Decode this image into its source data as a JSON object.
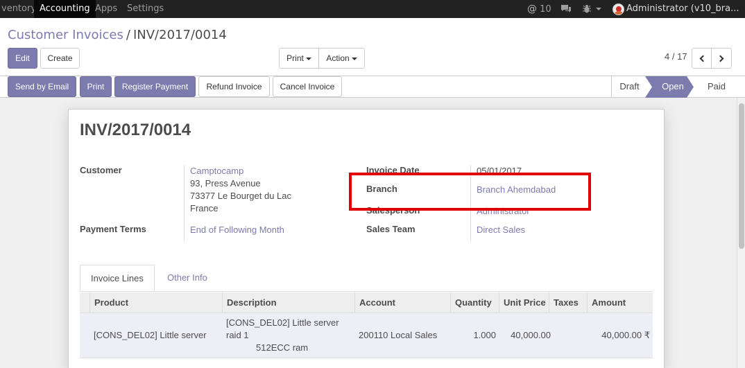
{
  "topbar": {
    "menus": [
      "ventory",
      "Accounting",
      "Apps",
      "Settings"
    ],
    "mentions": "10",
    "user": "Administrator (v10_bra..."
  },
  "breadcrumb": {
    "parent": "Customer Invoices",
    "separator": "/",
    "current": "INV/2017/0014"
  },
  "toolbar": {
    "edit": "Edit",
    "create": "Create",
    "print": "Print",
    "action": "Action",
    "pager": "4 / 17"
  },
  "actions": {
    "send_email": "Send by Email",
    "print": "Print",
    "register_payment": "Register Payment",
    "refund": "Refund Invoice",
    "cancel": "Cancel Invoice"
  },
  "stages": [
    "Draft",
    "Open",
    "Paid"
  ],
  "invoice": {
    "number": "INV/2017/0014",
    "customer_label": "Customer",
    "customer_name": "Camptocamp",
    "address_line1": "93, Press Avenue",
    "address_line2": "73377 Le Bourget du Lac",
    "address_line3": "France",
    "payment_terms_label": "Payment Terms",
    "payment_terms": "End of Following Month",
    "invoice_date_label": "Invoice Date",
    "invoice_date": "05/01/2017",
    "branch_label": "Branch",
    "branch": "Branch Ahemdabad",
    "salesperson_label": "Salesperson",
    "salesperson": "Administrator",
    "sales_team_label": "Sales Team",
    "sales_team": "Direct Sales"
  },
  "tabs": {
    "lines": "Invoice Lines",
    "other": "Other Info"
  },
  "table": {
    "columns": [
      "Product",
      "Description",
      "Account",
      "Quantity",
      "Unit Price",
      "Taxes",
      "Amount"
    ],
    "rows": [
      {
        "product": "[CONS_DEL02] Little server",
        "desc1": "[CONS_DEL02] Little server",
        "desc2": "raid 1",
        "desc3": "512ECC ram",
        "account": "200110 Local Sales",
        "quantity": "1.000",
        "unit_price": "40,000.00",
        "taxes": "",
        "amount": "40,000.00 ₹"
      }
    ]
  },
  "colors": {
    "primary": "#7c7bad",
    "highlight": "#e00000",
    "navbar": "#222222"
  }
}
